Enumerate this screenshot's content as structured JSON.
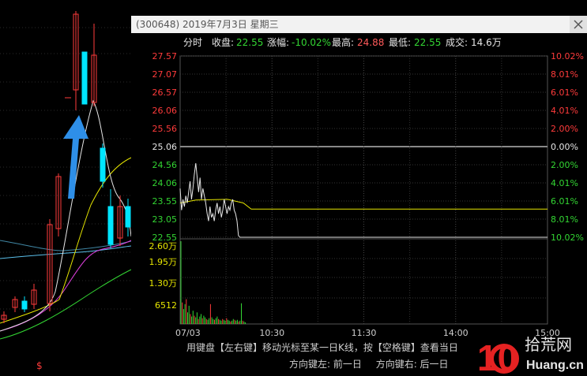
{
  "window": {
    "title": "(300648) 2019年7月3日 星期三"
  },
  "info": {
    "mode": "分时",
    "close_label": "收盘:",
    "close_value": "22.55",
    "change_label": "涨幅:",
    "change_value": "-10.02%",
    "high_label": "最高:",
    "high_value": "24.88",
    "low_label": "最低:",
    "low_value": "22.55",
    "volume_label": "成交:",
    "volume_value": "14.6万"
  },
  "axes": {
    "price_labels": [
      "27.57",
      "27.07",
      "26.57",
      "26.06",
      "25.56",
      "25.06",
      "24.56",
      "24.06",
      "23.55",
      "23.05",
      "22.55"
    ],
    "pct_labels": [
      "10.02%",
      "8.01%",
      "6.01%",
      "4.01%",
      "2.00%",
      "0.00%",
      "2.00%",
      "4.01%",
      "6.01%",
      "8.01%",
      "10.02%"
    ],
    "vol_labels": [
      "2.60万",
      "1.95万",
      "1.30万",
      "6512"
    ],
    "time_labels": [
      "07/03",
      "10:30",
      "11:30",
      "14:00",
      "15:00"
    ]
  },
  "hints": {
    "line1": "用键盘【左右键】移动光标至某一日K线，按【空格键】查看当日",
    "left": "方向键左: 前一日",
    "right": "方向键右: 后一日"
  },
  "logo": {
    "big": "10",
    "cn": "拾荒网",
    "en": "Huang.cn"
  },
  "bg_marker": "$",
  "colors": {
    "up": "#ff3b3b",
    "down": "#00e5ff",
    "green": "#33d633",
    "white": "#e6e6e6",
    "yellow": "#e6e600",
    "grid": "#333333"
  }
}
